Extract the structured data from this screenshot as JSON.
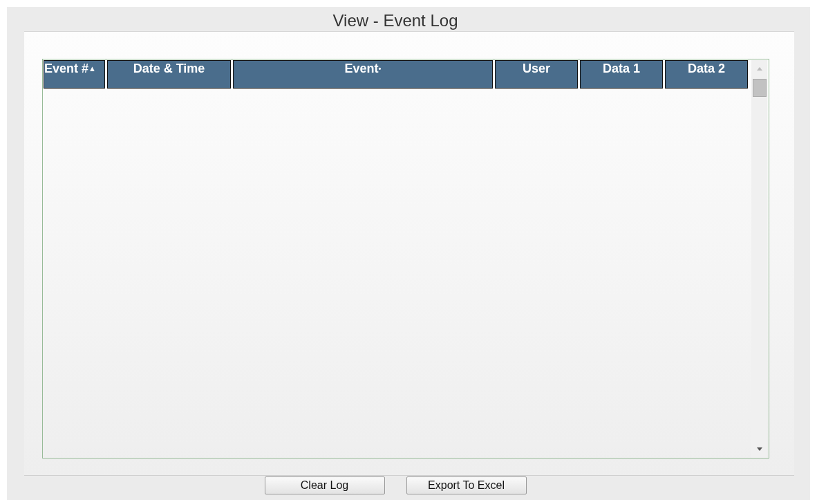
{
  "window": {
    "title": "View - Event Log"
  },
  "table": {
    "columns": [
      {
        "label": "Event #",
        "mark": "▲"
      },
      {
        "label": "Date & Time"
      },
      {
        "label": "Event",
        "mark": "•"
      },
      {
        "label": "User"
      },
      {
        "label": "Data 1"
      },
      {
        "label": "Data 2"
      }
    ]
  },
  "buttons": [
    "Clear Log",
    "Export To Excel"
  ]
}
